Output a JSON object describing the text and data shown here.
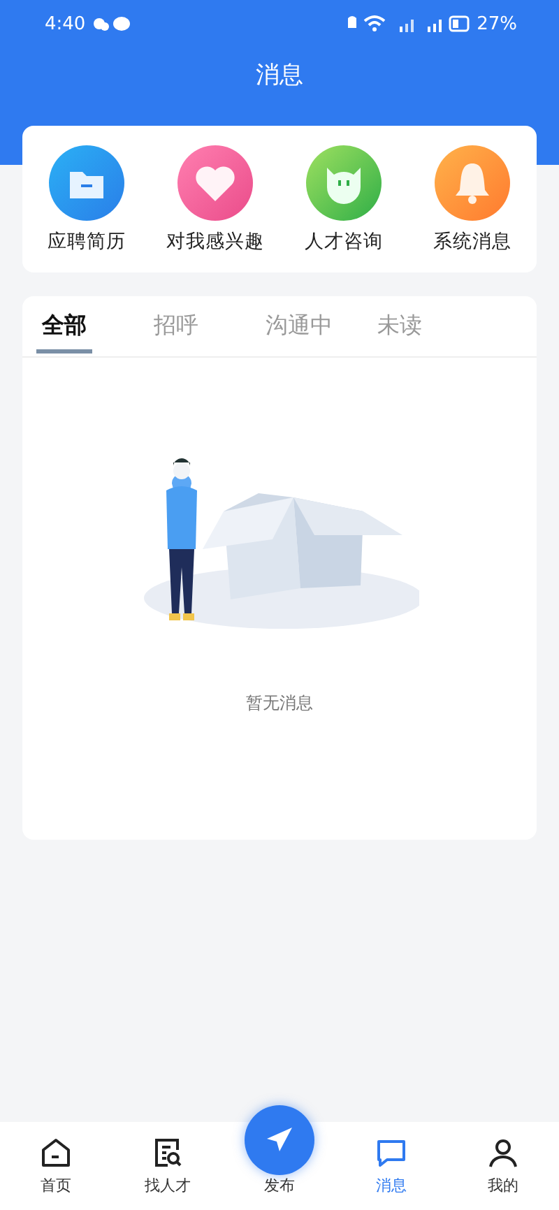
{
  "status_bar": {
    "time": "4:40",
    "battery": "27%"
  },
  "header": {
    "title": "消息"
  },
  "shortcuts": [
    {
      "label": "应聘简历",
      "kind": "folder"
    },
    {
      "label": "对我感兴趣",
      "kind": "heart"
    },
    {
      "label": "人才咨询",
      "kind": "face"
    },
    {
      "label": "系统消息",
      "kind": "bell"
    }
  ],
  "tabs": [
    {
      "label": "全部",
      "selected": true
    },
    {
      "label": "招呼",
      "selected": false
    },
    {
      "label": "沟通中",
      "selected": false
    },
    {
      "label": "未读",
      "selected": false
    }
  ],
  "empty_state": {
    "text": "暂无消息"
  },
  "bottom_nav": [
    {
      "label": "首页",
      "kind": "home",
      "selected": false
    },
    {
      "label": "找人才",
      "kind": "search",
      "selected": false
    },
    {
      "label": "发布",
      "kind": "publish",
      "selected": false
    },
    {
      "label": "消息",
      "kind": "message",
      "selected": true
    },
    {
      "label": "我的",
      "kind": "user",
      "selected": false
    }
  ]
}
